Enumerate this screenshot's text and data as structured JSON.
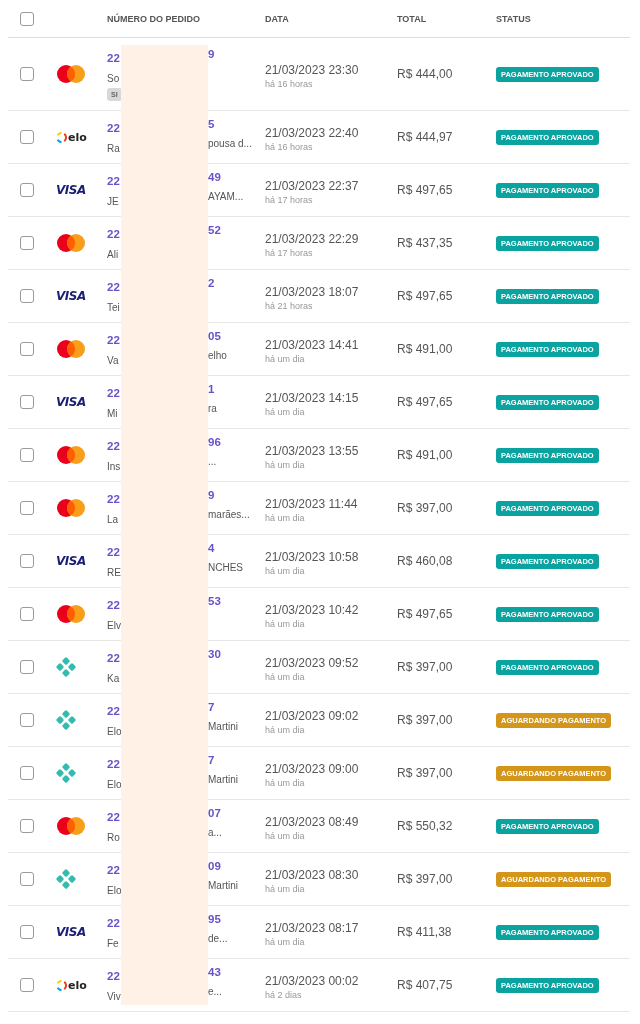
{
  "table": {
    "columns": [
      "NÚMERO DO PEDIDO",
      "DATA",
      "TOTAL",
      "STATUS"
    ],
    "select_all": {
      "checked": false
    },
    "rows": [
      {
        "checked": false,
        "payment": {
          "kind": "mastercard"
        },
        "order_start": "22",
        "order_end": "9",
        "name_start": "So",
        "name_end": "",
        "tag": "SI",
        "date": "21/03/2023 23:30",
        "ago": "há 16 horas",
        "total": "R$ 444,00",
        "status": {
          "kind": "approved",
          "label": "PAGAMENTO APROVADO"
        }
      },
      {
        "checked": false,
        "payment": {
          "kind": "elo",
          "label": "elo"
        },
        "order_start": "22",
        "order_end": "5",
        "name_start": "Ra",
        "name_end": "pousa d...",
        "date": "21/03/2023 22:40",
        "ago": "há 16 horas",
        "total": "R$ 444,97",
        "status": {
          "kind": "approved",
          "label": "PAGAMENTO APROVADO"
        }
      },
      {
        "checked": false,
        "payment": {
          "kind": "visa",
          "label": "VISA"
        },
        "order_start": "22",
        "order_end": "49",
        "name_start": "JE",
        "name_end": "AYAM...",
        "date": "21/03/2023 22:37",
        "ago": "há 17 horas",
        "total": "R$ 497,65",
        "status": {
          "kind": "approved",
          "label": "PAGAMENTO APROVADO"
        }
      },
      {
        "checked": false,
        "payment": {
          "kind": "mastercard"
        },
        "order_start": "22",
        "order_end": "52",
        "name_start": "Ali",
        "name_end": "",
        "date": "21/03/2023 22:29",
        "ago": "há 17 horas",
        "total": "R$ 437,35",
        "status": {
          "kind": "approved",
          "label": "PAGAMENTO APROVADO"
        }
      },
      {
        "checked": false,
        "payment": {
          "kind": "visa",
          "label": "VISA"
        },
        "order_start": "22",
        "order_end": "2",
        "name_start": "Tei",
        "name_end": "",
        "date": "21/03/2023 18:07",
        "ago": "há 21 horas",
        "total": "R$ 497,65",
        "status": {
          "kind": "approved",
          "label": "PAGAMENTO APROVADO"
        }
      },
      {
        "checked": false,
        "payment": {
          "kind": "mastercard"
        },
        "order_start": "22",
        "order_end": "05",
        "name_start": "Va",
        "name_end": "elho",
        "date": "21/03/2023 14:41",
        "ago": "há um dia",
        "total": "R$ 491,00",
        "status": {
          "kind": "approved",
          "label": "PAGAMENTO APROVADO"
        }
      },
      {
        "checked": false,
        "payment": {
          "kind": "visa",
          "label": "VISA"
        },
        "order_start": "22",
        "order_end": "1",
        "name_start": "Mi",
        "name_end": "ra",
        "date": "21/03/2023 14:15",
        "ago": "há um dia",
        "total": "R$ 497,65",
        "status": {
          "kind": "approved",
          "label": "PAGAMENTO APROVADO"
        }
      },
      {
        "checked": false,
        "payment": {
          "kind": "mastercard"
        },
        "order_start": "22",
        "order_end": "96",
        "name_start": "Ins",
        "name_end": "...",
        "date": "21/03/2023 13:55",
        "ago": "há um dia",
        "total": "R$ 491,00",
        "status": {
          "kind": "approved",
          "label": "PAGAMENTO APROVADO"
        }
      },
      {
        "checked": false,
        "payment": {
          "kind": "mastercard"
        },
        "order_start": "22",
        "order_end": "9",
        "name_start": "La",
        "name_end": "marães...",
        "date": "21/03/2023 11:44",
        "ago": "há um dia",
        "total": "R$ 397,00",
        "status": {
          "kind": "approved",
          "label": "PAGAMENTO APROVADO"
        }
      },
      {
        "checked": false,
        "payment": {
          "kind": "visa",
          "label": "VISA"
        },
        "order_start": "22",
        "order_end": "4",
        "name_start": "RE",
        "name_end": "NCHES",
        "date": "21/03/2023 10:58",
        "ago": "há um dia",
        "total": "R$ 460,08",
        "status": {
          "kind": "approved",
          "label": "PAGAMENTO APROVADO"
        }
      },
      {
        "checked": false,
        "payment": {
          "kind": "mastercard"
        },
        "order_start": "22",
        "order_end": "53",
        "name_start": "Elv",
        "name_end": "",
        "date": "21/03/2023 10:42",
        "ago": "há um dia",
        "total": "R$ 497,65",
        "status": {
          "kind": "approved",
          "label": "PAGAMENTO APROVADO"
        }
      },
      {
        "checked": false,
        "payment": {
          "kind": "pix"
        },
        "order_start": "22",
        "order_end": "30",
        "name_start": "Ka",
        "name_end": "",
        "date": "21/03/2023 09:52",
        "ago": "há um dia",
        "total": "R$ 397,00",
        "status": {
          "kind": "approved",
          "label": "PAGAMENTO APROVADO"
        }
      },
      {
        "checked": false,
        "payment": {
          "kind": "pix"
        },
        "order_start": "22",
        "order_end": "7",
        "name_start": "Elo",
        "name_end": "Martini",
        "date": "21/03/2023 09:02",
        "ago": "há um dia",
        "total": "R$ 397,00",
        "status": {
          "kind": "pending",
          "label": "AGUARDANDO PAGAMENTO"
        }
      },
      {
        "checked": false,
        "payment": {
          "kind": "pix"
        },
        "order_start": "22",
        "order_end": "7",
        "name_start": "Elo",
        "name_end": "Martini",
        "date": "21/03/2023 09:00",
        "ago": "há um dia",
        "total": "R$ 397,00",
        "status": {
          "kind": "pending",
          "label": "AGUARDANDO PAGAMENTO"
        }
      },
      {
        "checked": false,
        "payment": {
          "kind": "mastercard"
        },
        "order_start": "22",
        "order_end": "07",
        "name_start": "Ro",
        "name_end": "a...",
        "date": "21/03/2023 08:49",
        "ago": "há um dia",
        "total": "R$ 550,32",
        "status": {
          "kind": "approved",
          "label": "PAGAMENTO APROVADO"
        }
      },
      {
        "checked": false,
        "payment": {
          "kind": "pix"
        },
        "order_start": "22",
        "order_end": "09",
        "name_start": "Elo",
        "name_end": "Martini",
        "date": "21/03/2023 08:30",
        "ago": "há um dia",
        "total": "R$ 397,00",
        "status": {
          "kind": "pending",
          "label": "AGUARDANDO PAGAMENTO"
        }
      },
      {
        "checked": false,
        "payment": {
          "kind": "visa",
          "label": "VISA"
        },
        "order_start": "22",
        "order_end": "95",
        "name_start": "Fe",
        "name_end": "de...",
        "date": "21/03/2023 08:17",
        "ago": "há um dia",
        "total": "R$ 411,38",
        "status": {
          "kind": "approved",
          "label": "PAGAMENTO APROVADO"
        }
      },
      {
        "checked": false,
        "payment": {
          "kind": "elo",
          "label": "elo"
        },
        "order_start": "22",
        "order_end": "43",
        "name_start": "Viv",
        "name_end": "e...",
        "date": "21/03/2023 00:02",
        "ago": "há 2 dias",
        "total": "R$ 407,75",
        "status": {
          "kind": "approved",
          "label": "PAGAMENTO APROVADO"
        }
      }
    ]
  }
}
